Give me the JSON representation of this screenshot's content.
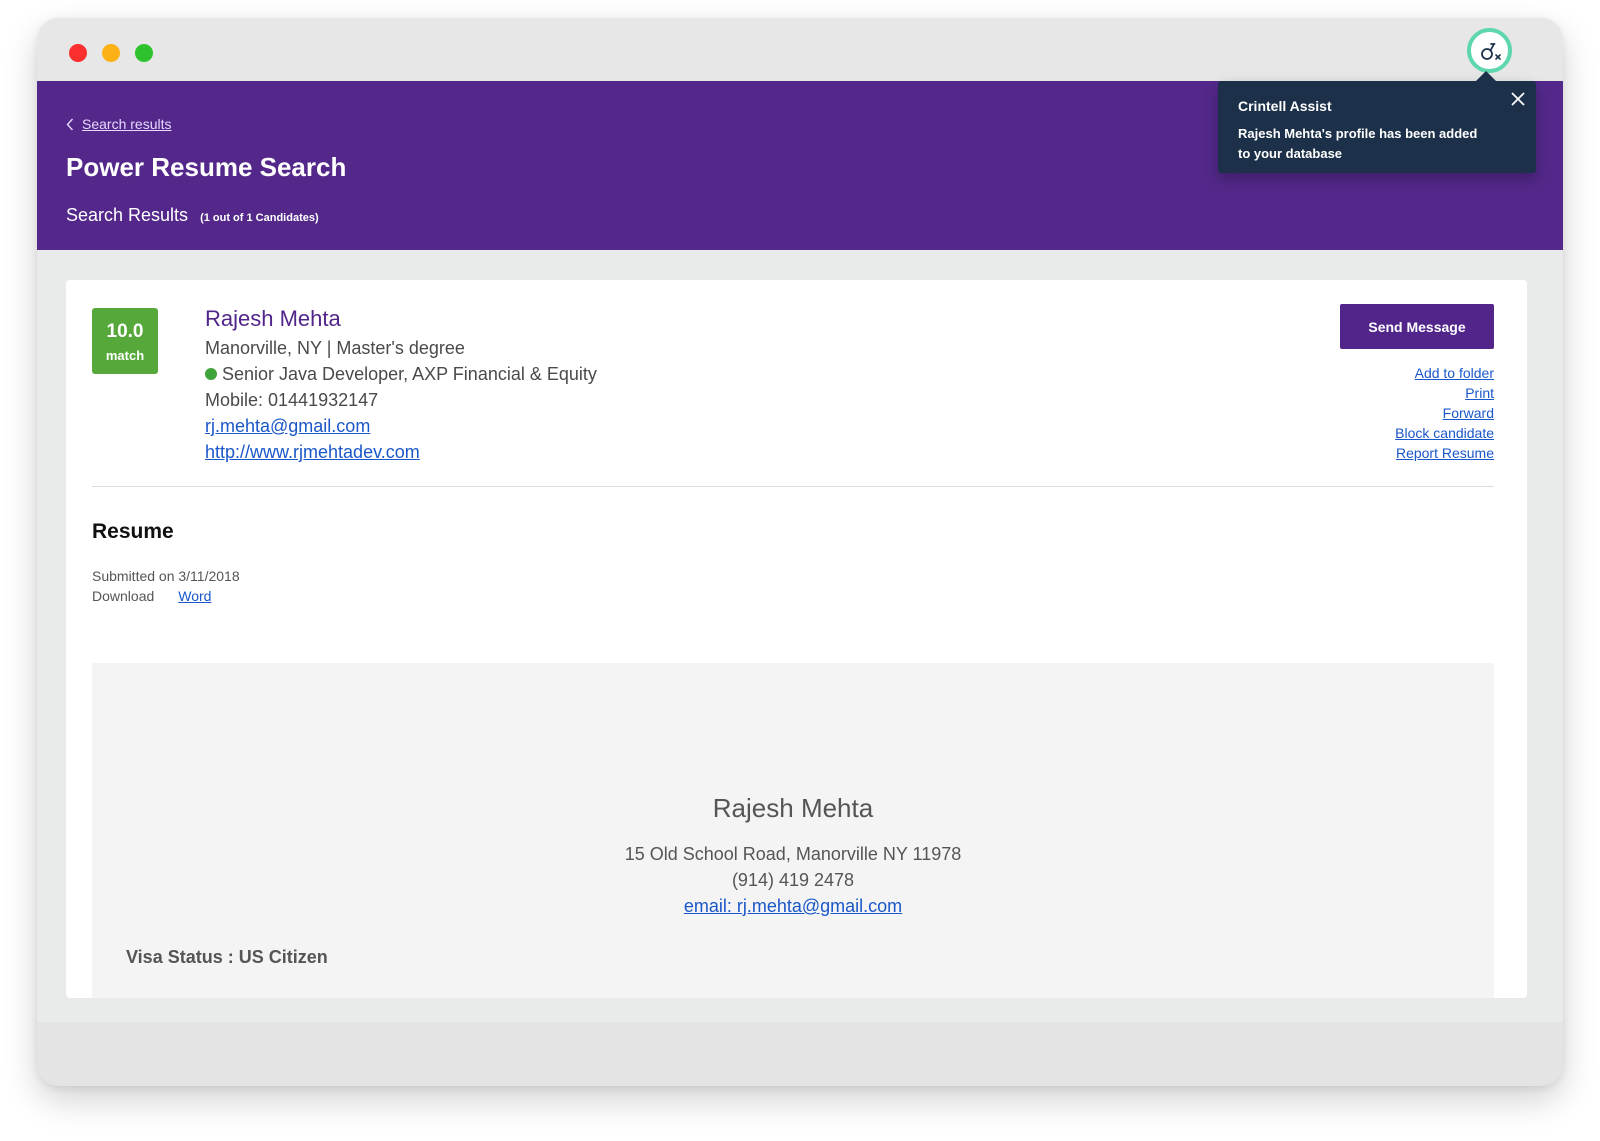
{
  "extension": {
    "icon": "crintell-assist-icon"
  },
  "header": {
    "breadcrumb_label": "Search results",
    "title": "Power Resume Search",
    "results_label": "Search Results",
    "results_count": "(1 out of 1 Candidates)"
  },
  "assist": {
    "title": "Crintell Assist",
    "message": "Rajesh Mehta's profile has been added to your database"
  },
  "candidate": {
    "match_score": "10.0",
    "match_label": "match",
    "name": "Rajesh Mehta",
    "location_degree": "Manorville, NY | Master's degree",
    "job": "Senior Java Developer, AXP Financial & Equity",
    "mobile": "Mobile: 01441932147",
    "email": "rj.mehta@gmail.com",
    "website": "http://www.rjmehtadev.com"
  },
  "actions": {
    "send_message": "Send Message",
    "add_to_folder": "Add to folder",
    "print": "Print",
    "forward": "Forward",
    "block": "Block candidate",
    "report": "Report Resume"
  },
  "resume": {
    "heading": "Resume",
    "submitted": "Submitted on 3/11/2018",
    "download_label": "Download",
    "download_link": "Word",
    "doc": {
      "name": "Rajesh Mehta",
      "address": "15 Old School Road, Manorville NY 11978",
      "phone": "(914) 419 2478",
      "email": "email: rj.mehta@gmail.com",
      "visa": "Visa Status : US Citizen"
    }
  },
  "colors": {
    "brand_purple": "#53288a",
    "assist_bg": "#1c3149",
    "match_green": "#55a839",
    "link_blue": "#1a57c9",
    "ext_ring": "#5fd7ad"
  }
}
